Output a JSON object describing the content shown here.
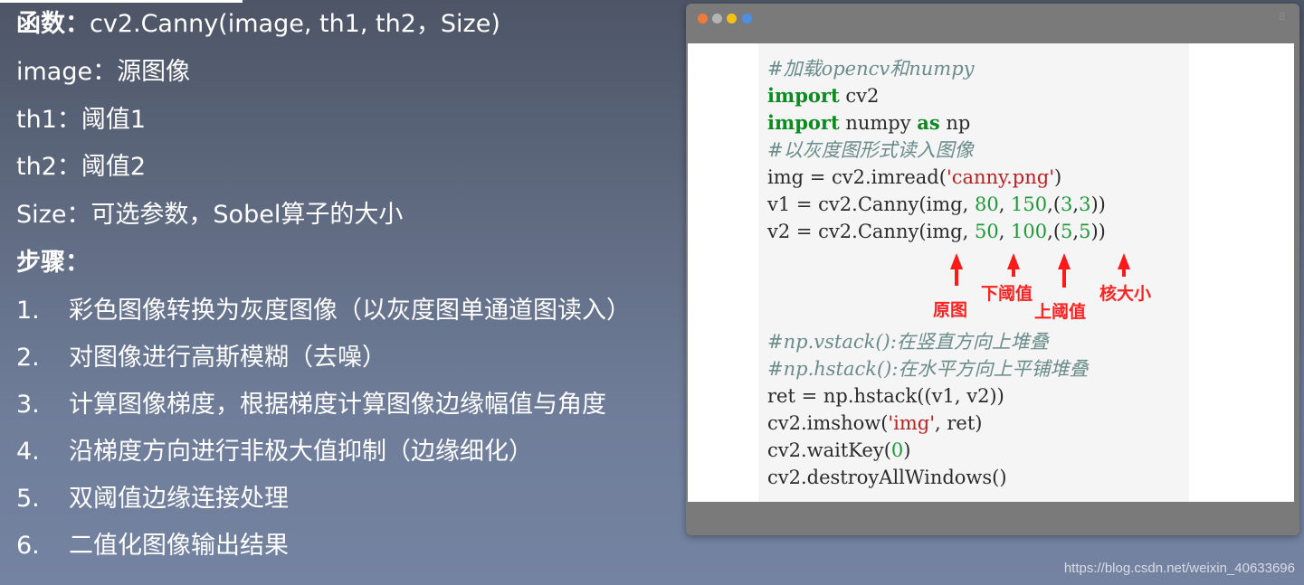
{
  "left": {
    "function_label": "函数：",
    "function_sig": "cv2.Canny(image, th1, th2，Size)",
    "params": [
      "image：源图像",
      "th1：阈值1",
      "th2：阈值2",
      "Size：可选参数，Sobel算子的大小"
    ],
    "steps_title": "步骤：",
    "steps": [
      {
        "num": "1.",
        "text": "彩色图像转换为灰度图像（以灰度图单通道图读入）"
      },
      {
        "num": "2.",
        "text": "对图像进行高斯模糊（去噪）"
      },
      {
        "num": "3.",
        "text": "计算图像梯度，根据梯度计算图像边缘幅值与角度"
      },
      {
        "num": "4.",
        "text": "沿梯度方向进行非极大值抑制（边缘细化）"
      },
      {
        "num": "5.",
        "text": "双阈值边缘连接处理"
      },
      {
        "num": "6.",
        "text": "二值化图像输出结果"
      }
    ]
  },
  "code": {
    "line1": "#加载opencv和numpy",
    "line2_kw": "import",
    "line2_rest": " cv2",
    "line3_kw": "import",
    "line3_mid": " numpy ",
    "line3_kw2": "as",
    "line3_rest": " np",
    "line4": "#以灰度图形式读入图像",
    "line5_a": "img = cv2.imread(",
    "line5_str": "'canny.png'",
    "line5_b": ")",
    "line6_a": "v1 = cv2.Canny(img, ",
    "line6_n1": "80",
    "line6_b": ", ",
    "line6_n2": "150",
    "line6_c": ",(",
    "line6_n3": "3",
    "line6_d": ",",
    "line6_n4": "3",
    "line6_e": "))",
    "line7_a": "v2 = cv2.Canny(img, ",
    "line7_n1": "50",
    "line7_b": ", ",
    "line7_n2": "100",
    "line7_c": ",(",
    "line7_n3": "5",
    "line7_d": ",",
    "line7_n4": "5",
    "line7_e": "))",
    "line8": "#np.vstack():在竖直方向上堆叠",
    "line9": "#np.hstack():在水平方向上平铺堆叠",
    "line10": "ret = np.hstack((v1, v2))",
    "line11_a": "cv2.imshow(",
    "line11_str": "'img'",
    "line11_b": ", ret)",
    "line12_a": "cv2.waitKey(",
    "line12_n": "0",
    "line12_b": ")",
    "line13": "cv2.destroyAllWindows()"
  },
  "annotations": {
    "src": "原图",
    "low": "下阈值",
    "high": "上阈值",
    "kernel": "核大小"
  },
  "watermark": "https://blog.csdn.net/weixin_40633696"
}
